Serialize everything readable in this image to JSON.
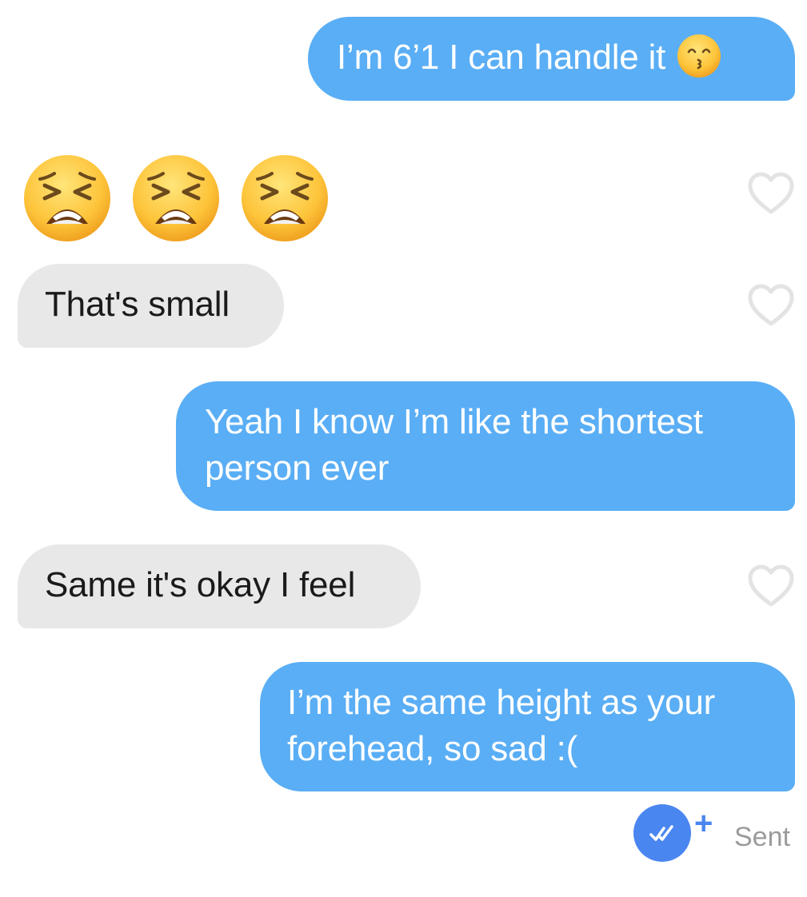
{
  "messages": [
    {
      "id": "m1",
      "direction": "outgoing",
      "text": "I’m 6’1 I can handle it",
      "trailing_emoji": "kissing-face-with-smiling-eyes"
    },
    {
      "id": "m2",
      "direction": "incoming",
      "type": "emoji-row",
      "emoji": [
        "tired-face",
        "tired-face",
        "tired-face"
      ]
    },
    {
      "id": "m3",
      "direction": "incoming",
      "text": "That's small"
    },
    {
      "id": "m4",
      "direction": "outgoing",
      "text_lines": [
        "Yeah I know I’m like the shortest",
        "person ever"
      ]
    },
    {
      "id": "m5",
      "direction": "incoming",
      "text": "Same it's okay I feel"
    },
    {
      "id": "m6",
      "direction": "outgoing",
      "text_lines": [
        "I’m the same height as your",
        "forehead, so sad :("
      ]
    }
  ],
  "footer": {
    "status_text": "Sent",
    "read_receipt_icon": "double-check-icon",
    "add_icon": "plus-icon"
  },
  "colors": {
    "outgoing_bubble": "#5aaef5",
    "incoming_bubble": "#e8e8e8",
    "receipt": "#4a86f0",
    "heart_outline": "#e3e3e3",
    "status_text": "#9b9b9b"
  }
}
